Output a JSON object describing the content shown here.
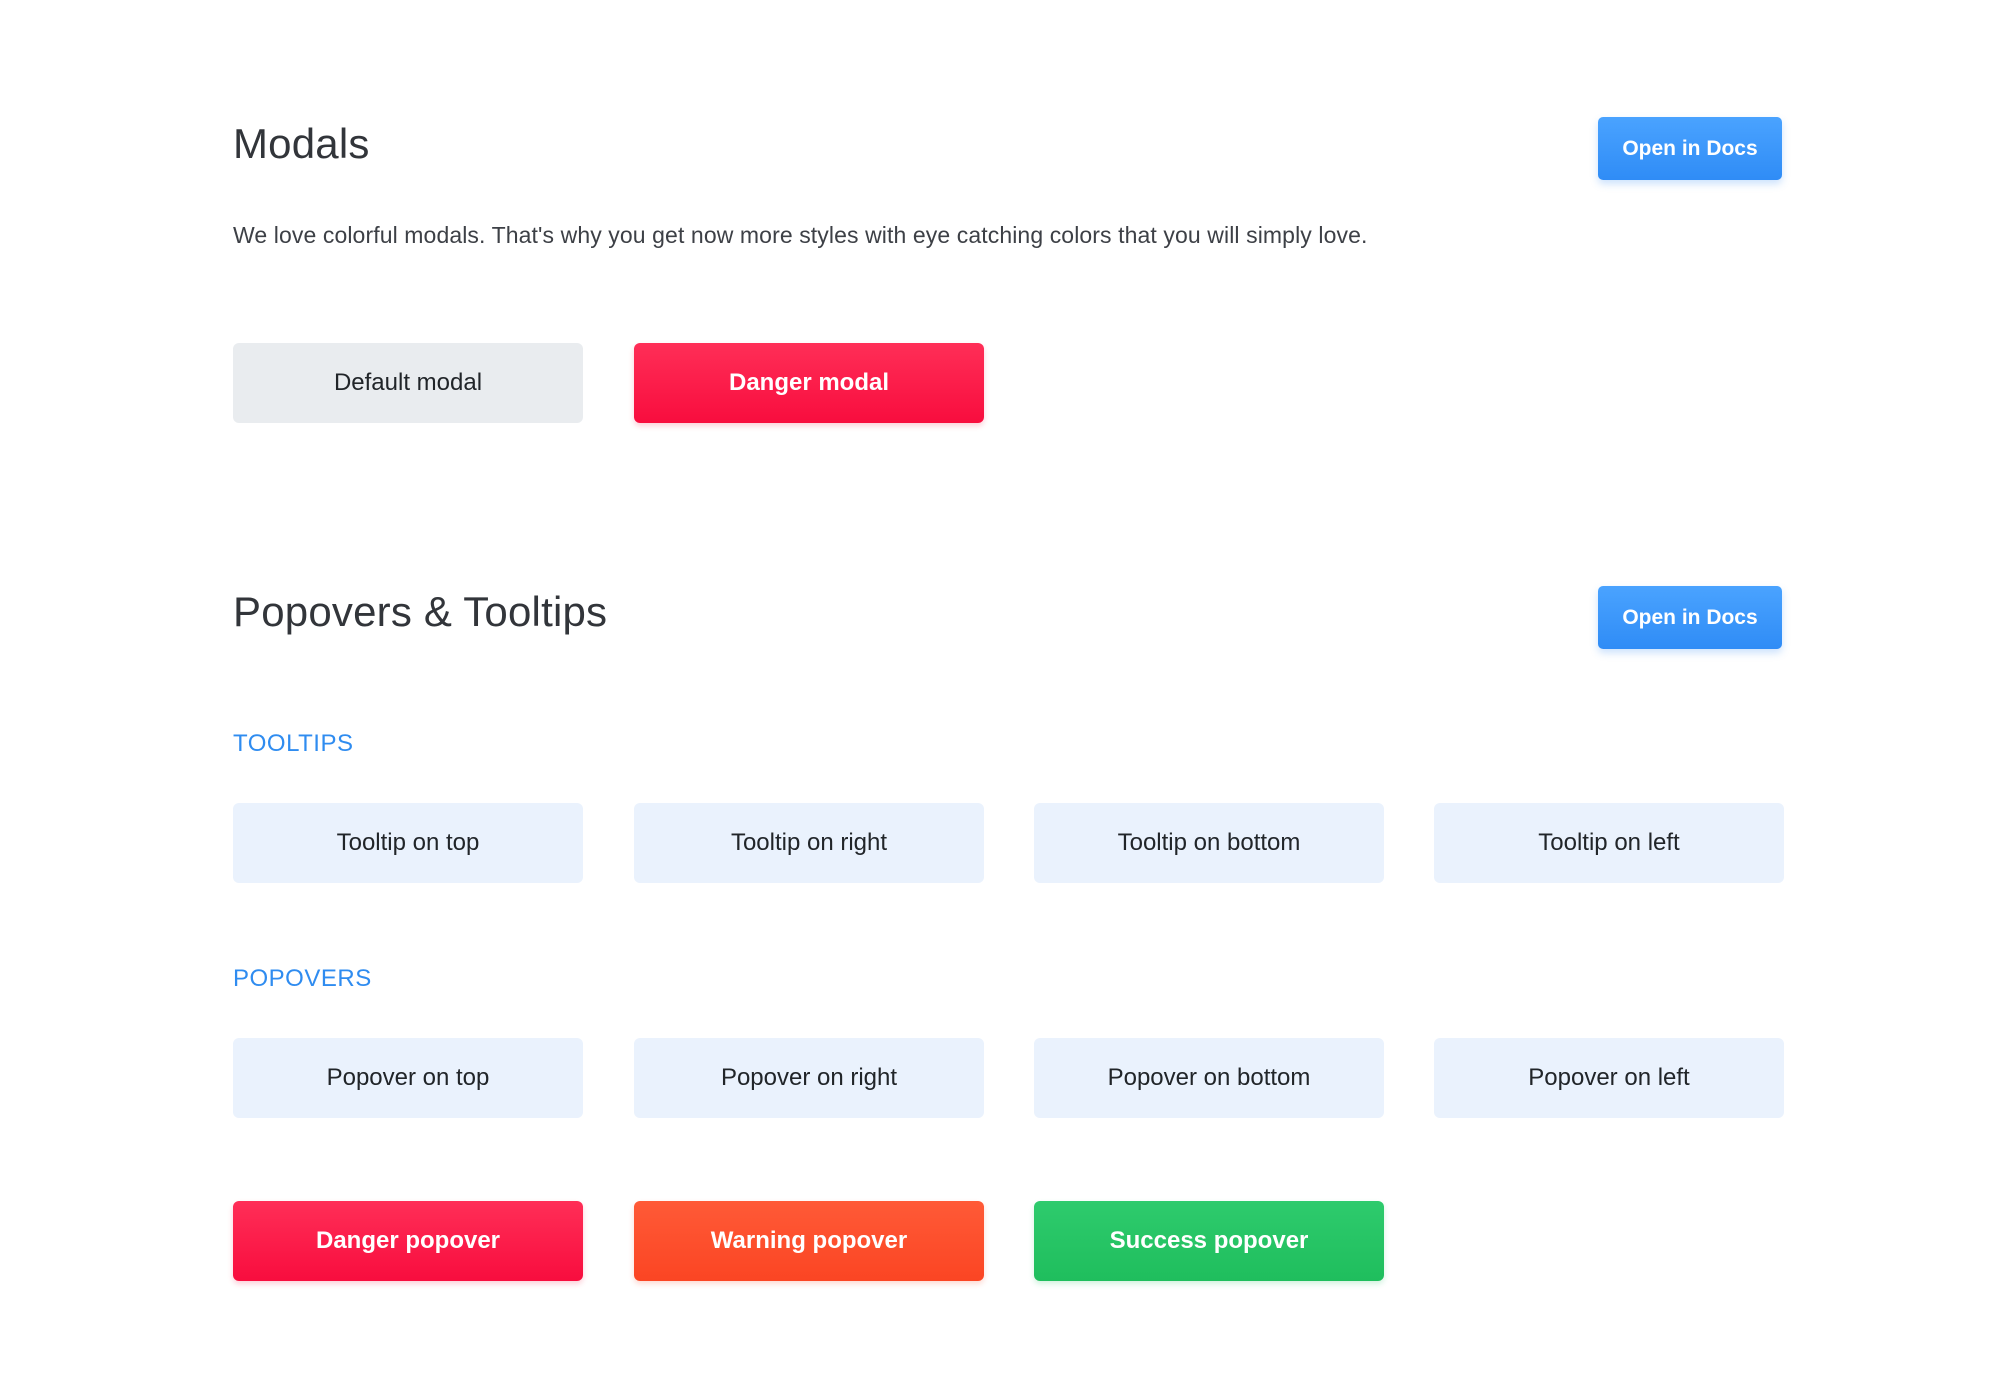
{
  "modals": {
    "title": "Modals",
    "docs_label": "Open in Docs",
    "description": "We love colorful modals. That's why you get now more styles with eye catching colors that you will simply love.",
    "buttons": [
      "Default modal",
      "Danger modal"
    ]
  },
  "popovers_tooltips": {
    "title": "Popovers & Tooltips",
    "docs_label": "Open in Docs",
    "tooltips": {
      "label": "TOOLTIPS",
      "buttons": [
        "Tooltip on top",
        "Tooltip on right",
        "Tooltip on bottom",
        "Tooltip on left"
      ]
    },
    "popovers": {
      "label": "POPOVERS",
      "buttons": [
        "Popover on top",
        "Popover on right",
        "Popover on bottom",
        "Popover on left"
      ],
      "colored_buttons": [
        "Danger popover",
        "Warning popover",
        "Success popover"
      ]
    }
  },
  "colors": {
    "primary": "#2f8cf6",
    "danger": "#f80d3e",
    "warning": "#fb4523",
    "success": "#1fbe5d",
    "soft": "#eaf2fd",
    "default": "#e9ecef"
  }
}
